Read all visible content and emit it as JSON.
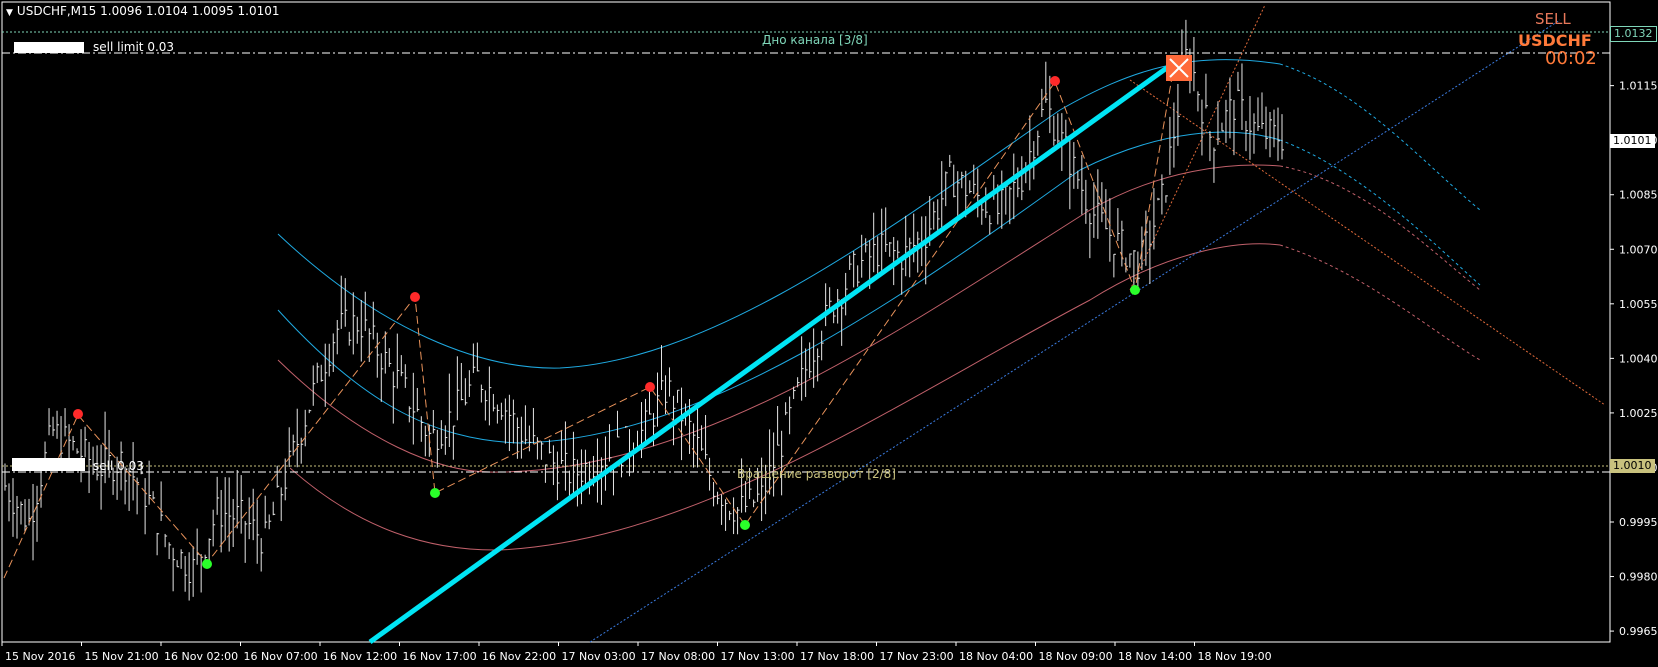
{
  "header": {
    "title": "USDCHF,M15  1.0096 1.0104 1.0095 1.0101"
  },
  "orders": {
    "sell_limit_label": "sell limit 0.03",
    "sell_label": "sell 0.03"
  },
  "levels": {
    "top_label": "Дно канала [3/8]",
    "bottom_label": "Вращение разворот [2/8]"
  },
  "signal": {
    "direction": "SELL",
    "symbol": "USDCHF",
    "timer": "00:02"
  },
  "price_tags": {
    "top": "1.0132",
    "current": "1.0101",
    "bottom": "1.0010"
  },
  "colors": {
    "background": "#000000",
    "axis": "#ffffff",
    "channel_blue": "#1fa9e0",
    "channel_red": "#c0606a",
    "trend_cyan": "#00e5f5",
    "zigzag": "#e8925a",
    "top_level": "#7fd6b9",
    "bottom_level": "#c9c27e",
    "sell_signal": "#ff7a3a",
    "pivot_high": "#ff2a2a",
    "pivot_low": "#2aff2a"
  },
  "chart_data": {
    "type": "bar",
    "symbol": "USDCHF",
    "timeframe": "M15",
    "ylim": [
      0.9962,
      1.0138
    ],
    "y_ticks": [
      "1.0130",
      "1.0115",
      "1.0100",
      "1.0085",
      "1.0070",
      "1.0055",
      "1.0040",
      "1.0025",
      "1.0010",
      "0.9995",
      "0.9980",
      "0.9965"
    ],
    "x_ticks": [
      "15 Nov 2016",
      "15 Nov 21:00",
      "16 Nov 02:00",
      "16 Nov 07:00",
      "16 Nov 12:00",
      "16 Nov 17:00",
      "16 Nov 22:00",
      "17 Nov 03:00",
      "17 Nov 08:00",
      "17 Nov 13:00",
      "17 Nov 18:00",
      "17 Nov 23:00",
      "18 Nov 04:00",
      "18 Nov 09:00",
      "18 Nov 14:00",
      "18 Nov 19:00"
    ],
    "close_path": [
      1.0005,
      0.9995,
      1.002,
      1.0015,
      1.001,
      1.0012,
      1.0002,
      0.9988,
      0.9982,
      0.9998,
      0.9996,
      0.999,
      1.001,
      1.003,
      1.0048,
      1.005,
      1.004,
      1.003,
      1.0018,
      1.0025,
      1.0035,
      1.0028,
      1.0018,
      1.0012,
      1.0008,
      1.0012,
      1.0015,
      1.002,
      1.0032,
      1.002,
      1.0005,
      0.9998,
      1.0002,
      1.002,
      1.004,
      1.0055,
      1.0065,
      1.007,
      1.0068,
      1.0075,
      1.009,
      1.0085,
      1.008,
      1.009,
      1.011,
      1.0095,
      1.008,
      1.0072,
      1.0066,
      1.0085,
      1.0125,
      1.01,
      1.011,
      1.0102,
      1.0101
    ],
    "pivots": [
      {
        "kind": "high",
        "time": "15 Nov 17:00",
        "price": 1.0024
      },
      {
        "kind": "low",
        "time": "16 Nov 02:00",
        "price": 0.9985
      },
      {
        "kind": "high",
        "time": "16 Nov 16:00",
        "price": 1.0057
      },
      {
        "kind": "low",
        "time": "16 Nov 17:30",
        "price": 1.0
      },
      {
        "kind": "high",
        "time": "17 Nov 06:00",
        "price": 1.0032
      },
      {
        "kind": "low",
        "time": "17 Nov 13:00",
        "price": 0.9994
      },
      {
        "kind": "high",
        "time": "18 Nov 04:00",
        "price": 1.0119
      },
      {
        "kind": "low",
        "time": "18 Nov 12:00",
        "price": 1.006
      }
    ],
    "levels": [
      1.0132,
      1.001
    ]
  }
}
